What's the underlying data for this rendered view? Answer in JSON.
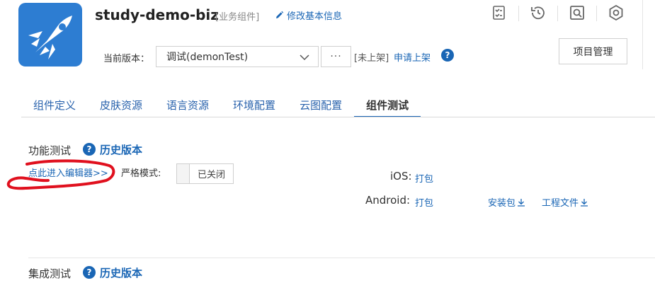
{
  "header": {
    "title": "study-demo-biz",
    "tag": "[业务组件]",
    "edit_label": "修改基本信息",
    "version_label": "当前版本：",
    "version_value": "调试(demonTest)",
    "more_label": "···",
    "status": "[未上架]",
    "apply_label": "申请上架",
    "help_glyph": "?",
    "project_button": "项目管理",
    "toolbar_icons": [
      "checklist-icon",
      "history-icon",
      "preview-icon",
      "settings-icon"
    ]
  },
  "tabs": [
    {
      "label": "组件定义",
      "active": false
    },
    {
      "label": "皮肤资源",
      "active": false
    },
    {
      "label": "语言资源",
      "active": false
    },
    {
      "label": "环境配置",
      "active": false
    },
    {
      "label": "云图配置",
      "active": false
    },
    {
      "label": "组件测试",
      "active": true
    }
  ],
  "function_test": {
    "title": "功能测试",
    "history_label": "历史版本",
    "editor_link": "点此进入编辑器>>",
    "strict_label": "严格模式:",
    "strict_toggle": "已关闭",
    "ios_label": "iOS:",
    "ios_pack": "打包",
    "android_label": "Android:",
    "android_pack": "打包",
    "install_label": "安装包",
    "project_file_label": "工程文件"
  },
  "integration_test": {
    "title": "集成测试",
    "history_label": "历史版本"
  },
  "colors": {
    "link": "#1a66b5",
    "logo_bg": "#2d7dd2",
    "annotation": "#e0101e"
  }
}
